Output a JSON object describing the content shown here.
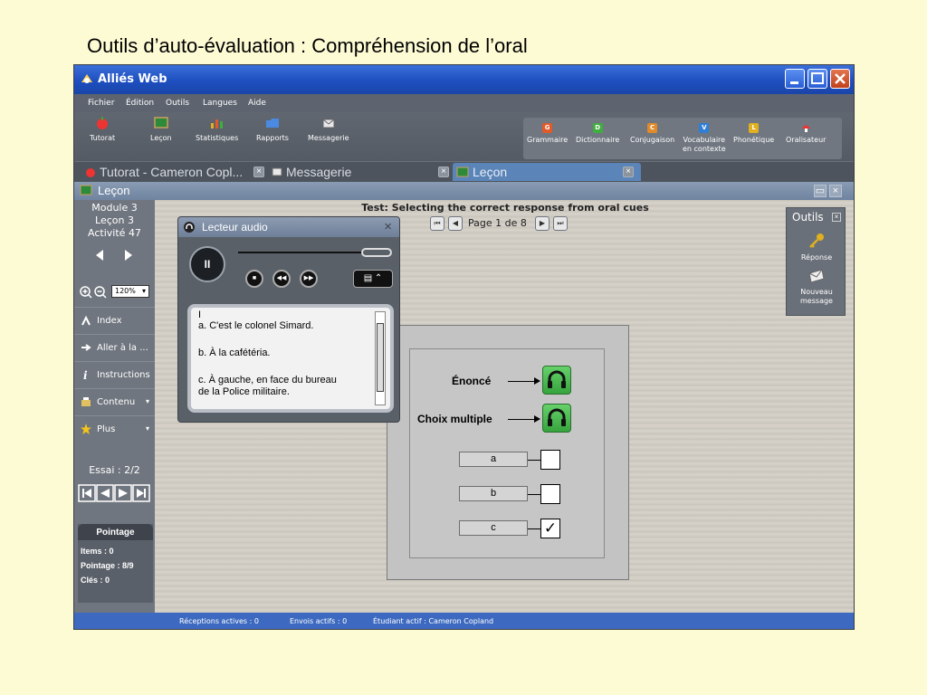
{
  "slide": {
    "title": "Outils d’auto-évaluation : Compréhension de l’oral"
  },
  "window": {
    "title": "Alliés Web"
  },
  "menu": [
    "Fichier",
    "Édition",
    "Outils",
    "Langues",
    "Aide"
  ],
  "toolbar": {
    "items": [
      "Tutorat",
      "Leçon",
      "Statistiques",
      "Rapports",
      "Messagerie"
    ],
    "refs": [
      {
        "label": "Grammaire",
        "letter": "G",
        "color": "#e05a2a"
      },
      {
        "label": "Dictionnaire",
        "letter": "D",
        "color": "#3fae3f"
      },
      {
        "label": "Conjugaison",
        "letter": "C",
        "color": "#e08a2a"
      },
      {
        "label": "Vocabulaire",
        "label2": "en contexte",
        "letter": "V",
        "color": "#2f7fd6"
      },
      {
        "label": "Phonétique",
        "letter": "L",
        "color": "#e0b020"
      },
      {
        "label": "Oralisateur",
        "letter": "",
        "color": ""
      }
    ]
  },
  "tabs": [
    "Tutorat - Cameron Copl...",
    "Messagerie",
    "Leçon"
  ],
  "lecon_bar": {
    "title": "Leçon"
  },
  "sidebar": {
    "module": "Module 3",
    "lecon": "Leçon 3",
    "activite": "Activité 47",
    "zoom": "120%",
    "items": [
      {
        "label": "Index"
      },
      {
        "label": "Aller à la ..."
      },
      {
        "label": "Instructions"
      },
      {
        "label": "Contenu"
      },
      {
        "label": "Plus"
      }
    ],
    "essai": "Essai : 2/2",
    "pointage": {
      "title": "Pointage",
      "items": "Items : 0",
      "score": "Pointage : 8/9",
      "cles": "Clés : 0"
    }
  },
  "content": {
    "test_title": "Test: Selecting the correct response from oral cues",
    "page": "Page 1 de 8",
    "enonce": "Énoncé",
    "choix": "Choix multiple",
    "options": [
      "a",
      "b",
      "c"
    ],
    "checked": [
      false,
      false,
      true
    ],
    "check_mark": "✓"
  },
  "outils": {
    "title": "Outils",
    "reponse": "Réponse",
    "nouveau1": "Nouveau",
    "nouveau2": "message"
  },
  "player": {
    "title": "Lecteur audio",
    "cursor": "I",
    "lines": [
      "a. C'est le colonel Simard.",
      "b. À la cafétéria.",
      "c. À gauche, en face du bureau",
      "de la Police militaire."
    ]
  },
  "status": {
    "receptions": "Réceptions actives : 0",
    "envois": "Envois actifs : 0",
    "etudiant": "Étudiant actif : Cameron Copland"
  }
}
